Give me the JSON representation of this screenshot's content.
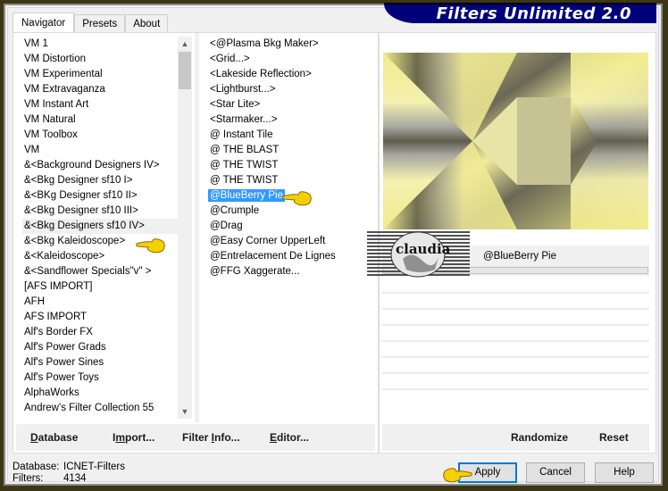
{
  "app": {
    "title": "Filters Unlimited 2.0"
  },
  "tabs": [
    {
      "label": "Navigator",
      "active": true
    },
    {
      "label": "Presets",
      "active": false
    },
    {
      "label": "About",
      "active": false
    }
  ],
  "categories": {
    "items": [
      {
        "label": " VM 1"
      },
      {
        "label": " VM Distortion"
      },
      {
        "label": " VM Experimental"
      },
      {
        "label": " VM Extravaganza"
      },
      {
        "label": " VM Instant Art"
      },
      {
        "label": " VM Natural"
      },
      {
        "label": " VM Toolbox"
      },
      {
        "label": " VM"
      },
      {
        "label": "&<Background Designers IV>"
      },
      {
        "label": "&<Bkg Designer sf10 I>"
      },
      {
        "label": "&<BKg Designer sf10 II>"
      },
      {
        "label": "&<Bkg Designer sf10 III>"
      },
      {
        "label": "&<Bkg Designers sf10 IV>",
        "highlighted": true
      },
      {
        "label": "&<Bkg Kaleidoscope>"
      },
      {
        "label": "&<Kaleidoscope>"
      },
      {
        "label": "&<Sandflower Specials\"v\" >"
      },
      {
        "label": "[AFS IMPORT]"
      },
      {
        "label": "AFH"
      },
      {
        "label": "AFS IMPORT"
      },
      {
        "label": "Alf's Border FX"
      },
      {
        "label": "Alf's Power Grads"
      },
      {
        "label": "Alf's Power Sines"
      },
      {
        "label": "Alf's Power Toys"
      },
      {
        "label": "AlphaWorks"
      },
      {
        "label": "Andrew's Filter Collection 55"
      }
    ]
  },
  "filters": {
    "items": [
      {
        "label": "<@Plasma Bkg Maker>"
      },
      {
        "label": "<Grid...>"
      },
      {
        "label": "<Lakeside Reflection>"
      },
      {
        "label": "<Lightburst...>"
      },
      {
        "label": "<Star Lite>"
      },
      {
        "label": "<Starmaker...>"
      },
      {
        "label": "@ Instant Tile"
      },
      {
        "label": "@ THE BLAST"
      },
      {
        "label": "@ THE TWIST"
      },
      {
        "label": "@ THE TWIST"
      },
      {
        "label": "@BlueBerry Pie",
        "selected": true
      },
      {
        "label": "@Crumple"
      },
      {
        "label": "@Drag"
      },
      {
        "label": "@Easy Corner UpperLeft"
      },
      {
        "label": "@Entrelacement De Lignes"
      },
      {
        "label": "@FFG Xaggerate..."
      }
    ]
  },
  "left_toolbar": {
    "database": {
      "pre": "",
      "u": "D",
      "post": "atabase"
    },
    "import": {
      "pre": "I",
      "u": "m",
      "post": "port..."
    },
    "filter_info": {
      "pre": "Filter ",
      "u": "I",
      "post": "nfo..."
    },
    "editor": {
      "pre": "",
      "u": "E",
      "post": "ditor..."
    }
  },
  "preview": {
    "filter_name": "@BlueBerry Pie",
    "progress": 0
  },
  "right_toolbar": {
    "randomize": "Randomize",
    "reset": "Reset"
  },
  "status": {
    "database_label": "Database:",
    "database_value": "ICNET-Filters",
    "filters_label": "Filters:",
    "filters_value": "4134"
  },
  "buttons": {
    "apply": "Apply",
    "cancel": "Cancel",
    "help": "Help"
  },
  "watermark": {
    "text": "claudia"
  },
  "colors": {
    "title_bar": "#00007b",
    "selection": "#3399ff",
    "outer_border": "#3c3616",
    "preview_yellow": "#f2ec8c",
    "preview_gray": "#6e6c5a"
  }
}
